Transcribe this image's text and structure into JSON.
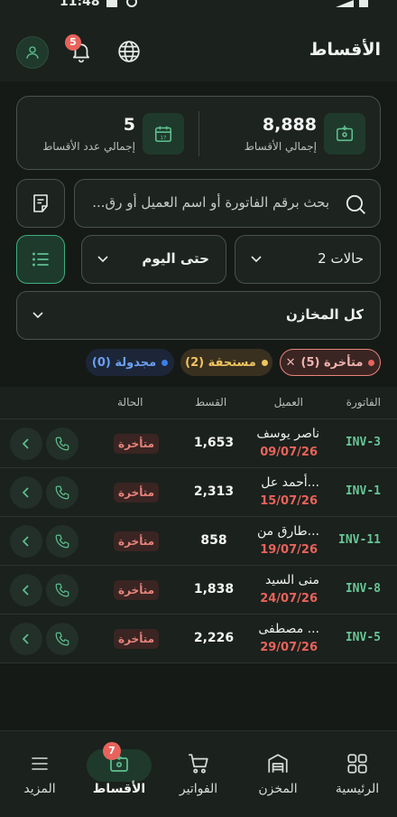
{
  "status_bar": {
    "time": "11:48"
  },
  "header": {
    "title": "الأقساط"
  },
  "notifications": {
    "count": "5"
  },
  "stats": {
    "total_installments_value": "8,888",
    "total_installments_label": "إجمالي الأقساط",
    "installments_count_value": "5",
    "installments_count_label": "إجمالي عدد الأقساط"
  },
  "search": {
    "placeholder": "بحث برقم الفاتورة أو اسم العميل أو رق..."
  },
  "filters": {
    "states_label": "2 حالات",
    "due_label": "حتى اليوم",
    "stores_label": "كل المخازن"
  },
  "chips": [
    {
      "label": "متأخرة (5)",
      "color": "#e8635b",
      "selected": true
    },
    {
      "label": "مستحقة (2)",
      "color": "#f0c560",
      "selected": false
    },
    {
      "label": "مجدولة (0)",
      "color": "#3d7ee8",
      "selected": false
    }
  ],
  "table": {
    "headers": {
      "invoice": "الفاتورة",
      "customer": "العميل",
      "installment": "القسط",
      "status": "الحالة"
    },
    "rows": [
      {
        "invoice": "INV-3",
        "customer": "ناصر يوسف",
        "date": "09/07/26",
        "amount": "1,653",
        "status": "متأخرة"
      },
      {
        "invoice": "INV-1",
        "customer": "أحمد عل...",
        "date": "15/07/26",
        "amount": "2,313",
        "status": "متأخرة"
      },
      {
        "invoice": "INV-11",
        "customer": "طارق من...",
        "date": "19/07/26",
        "amount": "858",
        "status": "متأخرة"
      },
      {
        "invoice": "INV-8",
        "customer": "منى السيد",
        "date": "24/07/26",
        "amount": "1,838",
        "status": "متأخرة"
      },
      {
        "invoice": "INV-5",
        "customer": "مصطفى ...",
        "date": "29/07/26",
        "amount": "2,226",
        "status": "متأخرة"
      }
    ]
  },
  "bottom_nav": {
    "home": "الرئيسية",
    "store": "المخزن",
    "invoices": "الفواتير",
    "installments": "الأقساط",
    "installments_badge": "7",
    "more": "المزيد"
  },
  "colors": {
    "accent": "#3fae7c",
    "overdue": "#e8635b",
    "due": "#f0c560",
    "scheduled": "#3d7ee8"
  }
}
